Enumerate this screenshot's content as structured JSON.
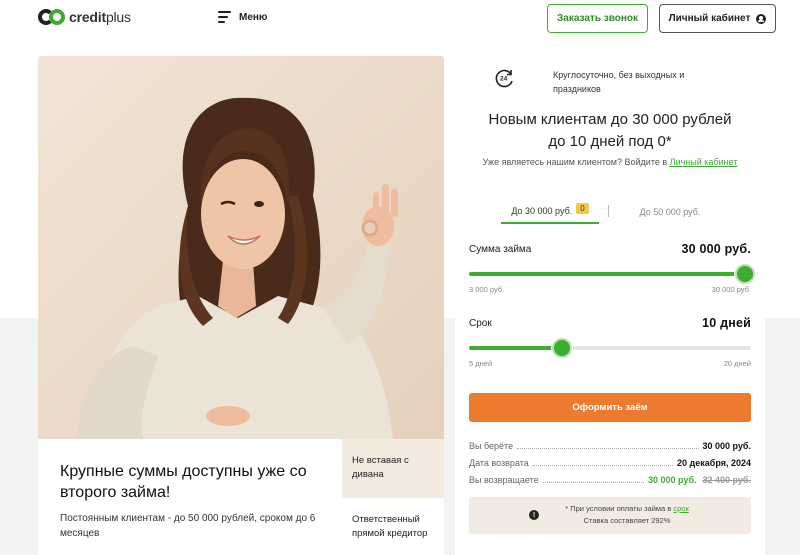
{
  "header": {
    "logo_bold": "credit",
    "logo_rest": "plus",
    "menu_label": "Меню",
    "call_button": "Заказать звонок",
    "cabinet_button": "Личный кабинет"
  },
  "promo": {
    "title": "Крупные суммы доступны уже со второго займа!",
    "text": "Постоянным клиентам - до 50 000 рублей, сроком до 6 месяцев"
  },
  "tiles": [
    {
      "label": "Не вставая с дивана"
    },
    {
      "label": "Ответственный прямой кредитор"
    }
  ],
  "panel": {
    "availability": "Круглосуточно, без выходных и праздников",
    "offer_line1": "Новым клиентам до 30 000 рублей",
    "offer_line2": "до 10 дней под 0*",
    "client_note": "Уже являетесь нашим клиентом? Войдите в ",
    "client_link": "Личный кабинет",
    "tabs": [
      {
        "label": "До 30 000 руб.",
        "badge": "0",
        "active": true
      },
      {
        "label": "До 50 000 руб.",
        "active": false
      }
    ],
    "amount": {
      "label": "Сумма займа",
      "value": "30 000 руб.",
      "min_label": "3 000 руб.",
      "max_label": "30 000 руб.",
      "level": 1.0
    },
    "term": {
      "label": "Срок",
      "value": "10 дней",
      "min_label": "5 дней",
      "max_label": "20 дней",
      "level": 0.33
    },
    "submit_button": "Оформить заём",
    "summary": {
      "take_label": "Вы берёте",
      "take_value": "30 000 руб.",
      "return_date_label": "Дата возврата",
      "return_date_value": "20 декабря, 2024",
      "pay_label": "Вы возвращаете",
      "pay_value": "30 000 руб.",
      "pay_old_value": "32 400 руб."
    },
    "notice": {
      "line1": "* При условии оплаты займа в ",
      "link": "срок",
      "line2": "Ставка составляет 292%"
    }
  },
  "colors": {
    "accent_green": "#3cad2f",
    "cta_orange": "#ee7a2f",
    "badge_yellow": "#f6c94b"
  }
}
